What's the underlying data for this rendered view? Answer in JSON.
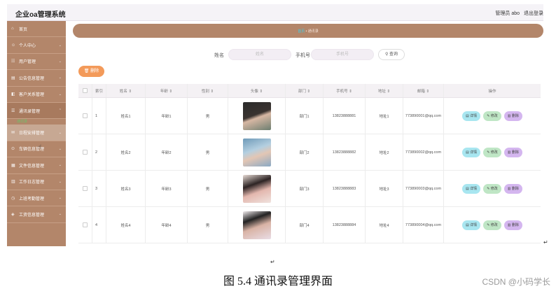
{
  "app": {
    "title": "企业oa管理系统",
    "admin": "管理员 abo",
    "logout": "退出登录"
  },
  "sidebar": {
    "items": [
      {
        "icon": "home-icon",
        "label": "首页"
      },
      {
        "icon": "user-icon",
        "label": "个人中心"
      },
      {
        "icon": "users-icon",
        "label": "用户管理"
      },
      {
        "icon": "notice-icon",
        "label": "公告信息管理"
      },
      {
        "icon": "customer-icon",
        "label": "客户关系管理"
      },
      {
        "icon": "contacts-icon",
        "label": "通讯录管理"
      },
      {
        "icon": "schedule-icon",
        "label": "日程安排管理"
      },
      {
        "icon": "car-icon",
        "label": "车辆信息管理"
      },
      {
        "icon": "file-icon",
        "label": "文件信息管理"
      },
      {
        "icon": "log-icon",
        "label": "工作日志管理"
      },
      {
        "icon": "attendance-icon",
        "label": "上班考勤管理"
      },
      {
        "icon": "salary-icon",
        "label": "工资信息管理"
      }
    ],
    "sub_label": "通讯录"
  },
  "breadcrumb": {
    "home": "首页",
    "sep": "•",
    "current": "通讯录"
  },
  "search": {
    "name_label": "姓名",
    "name_placeholder": "姓名",
    "phone_label": "手机号",
    "phone_placeholder": "手机号",
    "button": "查询"
  },
  "delete_button": "删除",
  "table": {
    "headers": [
      "索引",
      "姓名 ⇕",
      "年龄 ⇕",
      "性别 ⇕",
      "头像 ⇕",
      "部门 ⇕",
      "手机号 ⇕",
      "地址 ⇕",
      "邮箱 ⇕",
      "操作"
    ],
    "rows": [
      {
        "index": "1",
        "name": "姓名1",
        "age": "年龄1",
        "gender": "男",
        "dept": "部门1",
        "phone": "13823888881",
        "address": "地址1",
        "email": "773890001@qq.com"
      },
      {
        "index": "2",
        "name": "姓名2",
        "age": "年龄2",
        "gender": "男",
        "dept": "部门2",
        "phone": "13823888882",
        "address": "地址2",
        "email": "773890002@qq.com"
      },
      {
        "index": "3",
        "name": "姓名3",
        "age": "年龄3",
        "gender": "男",
        "dept": "部门3",
        "phone": "13823888883",
        "address": "地址3",
        "email": "773890003@qq.com"
      },
      {
        "index": "4",
        "name": "姓名4",
        "age": "年龄4",
        "gender": "男",
        "dept": "部门4",
        "phone": "13823888884",
        "address": "地址4",
        "email": "773890004@qq.com"
      }
    ],
    "actions": {
      "detail": "详情",
      "edit": "修改",
      "remove": "删除"
    }
  },
  "caption": "图 5.4 通讯录管理界面",
  "watermark": "CSDN @小码学长",
  "colors": {
    "sidebar": "#b3866a",
    "delete": "#f39a5a",
    "detail": "#a8e6f0",
    "edit": "#bfe6c5",
    "remove": "#d4b6ef"
  }
}
